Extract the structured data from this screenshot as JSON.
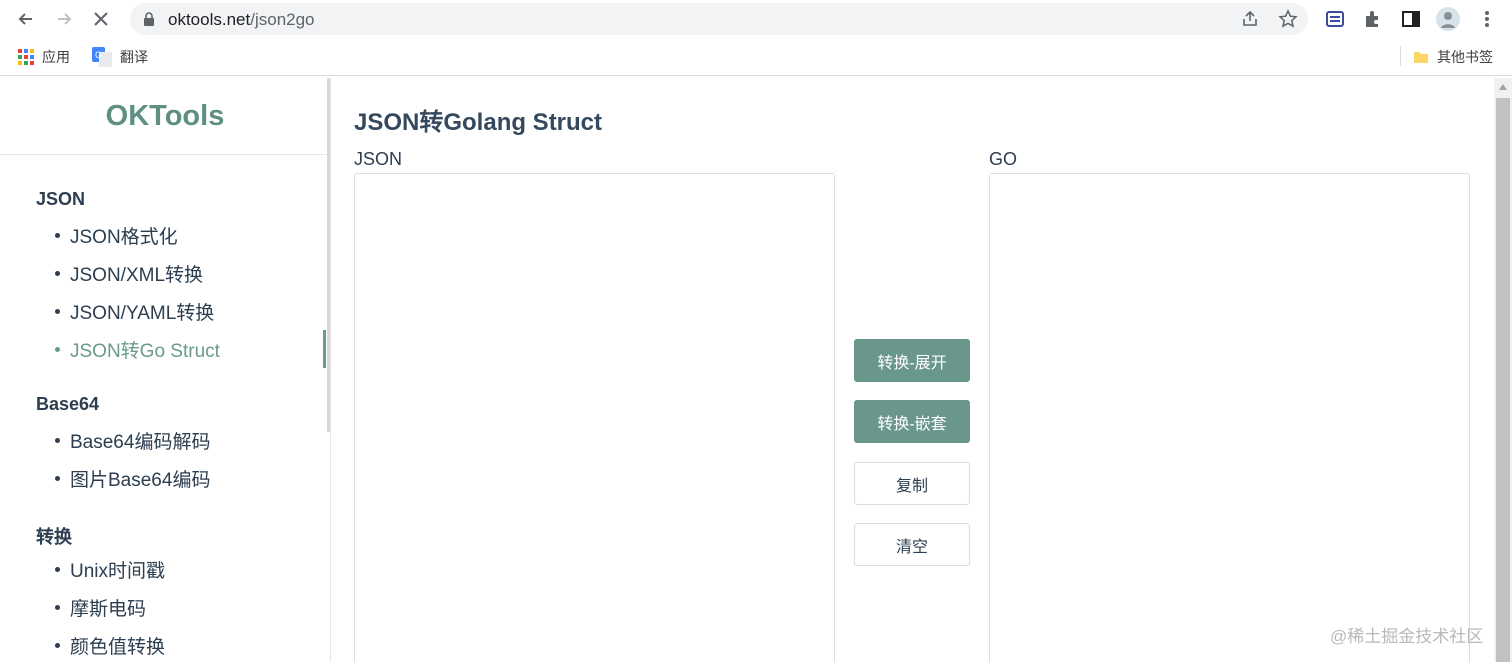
{
  "browser": {
    "url_host": "oktools.net",
    "url_path": "/json2go",
    "bookmarks": [
      {
        "label": "应用",
        "icon": "apps-grid-icon"
      },
      {
        "label": "翻译",
        "icon": "google-translate-icon"
      }
    ],
    "other_bookmarks": "其他书签"
  },
  "sidebar": {
    "logo": "OKTools",
    "groups": [
      {
        "title": "JSON",
        "items": [
          "JSON格式化",
          "JSON/XML转换",
          "JSON/YAML转换",
          "JSON转Go Struct"
        ]
      },
      {
        "title": "Base64",
        "items": [
          "Base64编码解码",
          "图片Base64编码"
        ]
      },
      {
        "title": "转换",
        "items": [
          "Unix时间戳",
          "摩斯电码",
          "颜色值转换"
        ]
      }
    ],
    "active_item": "JSON转Go Struct"
  },
  "main": {
    "title": "JSON转Golang Struct",
    "json_label": "JSON",
    "go_label": "GO",
    "json_value": "",
    "go_value": "",
    "buttons": {
      "expand": "转换-展开",
      "nested": "转换-嵌套",
      "copy": "复制",
      "clear": "清空"
    }
  },
  "watermark": "@稀土掘金技术社区",
  "colors": {
    "accent": "#6a978b",
    "logo": "#5d8f82",
    "text": "#2c3e50"
  }
}
